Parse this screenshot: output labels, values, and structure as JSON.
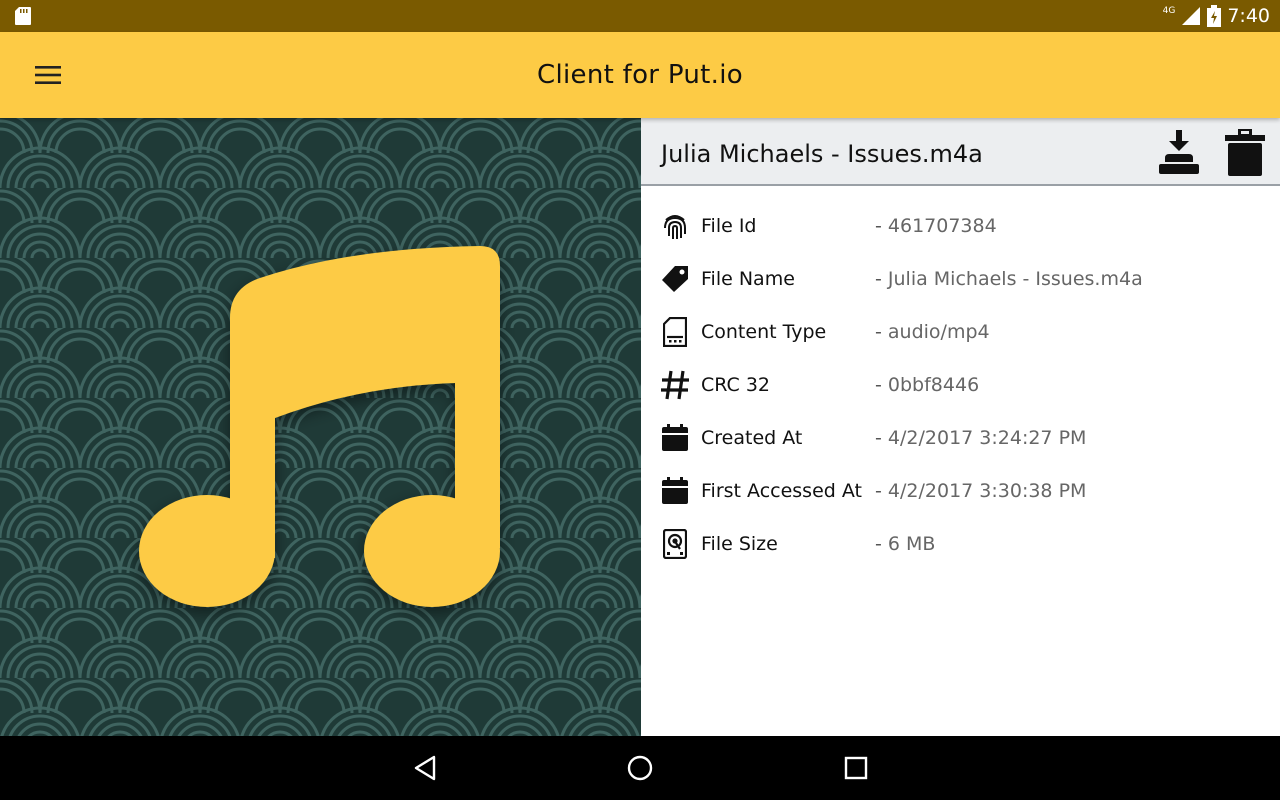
{
  "status_bar": {
    "time": "7:40",
    "network": "4G",
    "icons": [
      "sd-card-icon",
      "signal-icon",
      "battery-icon"
    ]
  },
  "app_bar": {
    "title": "Client for Put.io",
    "menu_icon": "hamburger-menu-icon"
  },
  "artwork": {
    "icon": "music-note-icon",
    "accent_color": "#fdcb45",
    "background_color": "#1f3a37"
  },
  "file": {
    "name": "Julia Michaels - Issues.m4a",
    "actions": [
      {
        "name": "download",
        "icon": "download-icon"
      },
      {
        "name": "delete",
        "icon": "trash-icon"
      }
    ],
    "details": [
      {
        "icon": "fingerprint-icon",
        "label": "File Id",
        "value": "461707384"
      },
      {
        "icon": "tag-icon",
        "label": "File Name",
        "value": "Julia Michaels - Issues.m4a"
      },
      {
        "icon": "sd-file-icon",
        "label": "Content Type",
        "value": "audio/mp4"
      },
      {
        "icon": "hash-icon",
        "label": "CRC 32",
        "value": "0bbf8446"
      },
      {
        "icon": "calendar-icon",
        "label": "Created At",
        "value": "4/2/2017 3:24:27 PM"
      },
      {
        "icon": "calendar-icon",
        "label": "First Accessed At",
        "value": "4/2/2017 3:30:38 PM"
      },
      {
        "icon": "harddisk-icon",
        "label": "File Size",
        "value": "6 MB"
      }
    ],
    "separator": "- "
  },
  "nav_bar": {
    "buttons": [
      "back-icon",
      "home-icon",
      "recents-icon"
    ]
  },
  "colors": {
    "status_bar": "#7a5a00",
    "app_bar": "#fdcb45",
    "header_bg": "#eceef0",
    "label": "#111111",
    "value": "#666666"
  }
}
